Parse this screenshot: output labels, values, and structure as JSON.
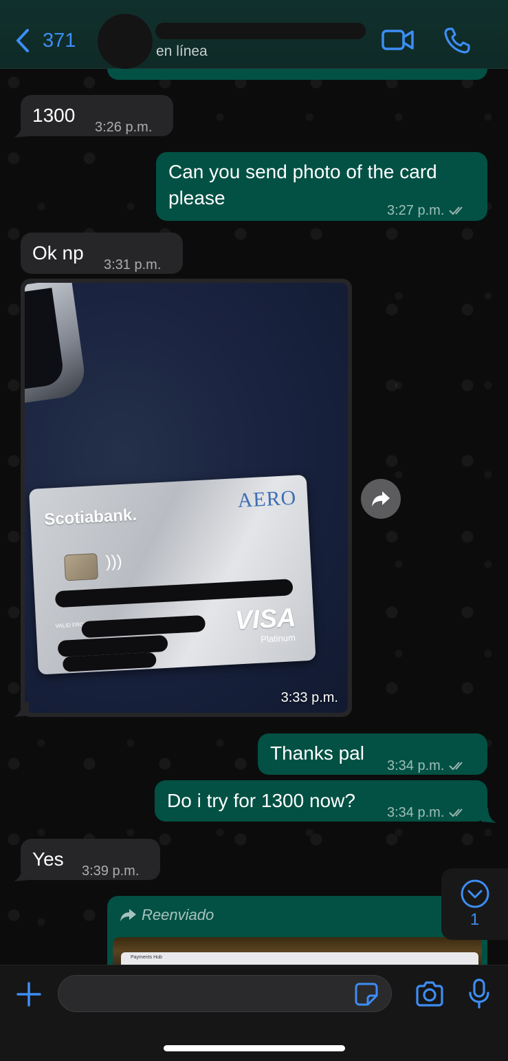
{
  "header": {
    "back_count": "371",
    "contact_status": "en línea"
  },
  "messages": [
    {
      "direction": "in",
      "text": "1300",
      "time": "3:26 p.m."
    },
    {
      "direction": "out",
      "text": "Can you send photo of the card please",
      "time": "3:27 p.m.",
      "status": "read"
    },
    {
      "direction": "in",
      "text": "Ok np",
      "time": "3:31 p.m."
    },
    {
      "direction": "in",
      "type": "photo",
      "time": "3:33 p.m.",
      "photo": {
        "bank": "Scotiabank.",
        "card_brand": "AERO",
        "network": "VISA",
        "tier": "Platinum",
        "valid_from": "VALID FROM"
      }
    },
    {
      "direction": "out",
      "text": "Thanks pal",
      "time": "3:34 p.m.",
      "status": "read"
    },
    {
      "direction": "out",
      "text": "Do i try for 1300 now?",
      "time": "3:34 p.m.",
      "status": "read"
    },
    {
      "direction": "in",
      "text": "Yes",
      "time": "3:39 p.m."
    },
    {
      "direction": "out",
      "type": "forwarded",
      "label": "Reenviado",
      "preview_tab": "Payments Hub"
    }
  ],
  "scroll_down": {
    "unread_count": "1"
  },
  "composer": {
    "placeholder": "",
    "value": ""
  },
  "colors": {
    "accent": "#3d8ef5",
    "outgoing_bubble": "#025144",
    "incoming_bubble": "#262628",
    "read_ticks": "#9fb7b2"
  }
}
